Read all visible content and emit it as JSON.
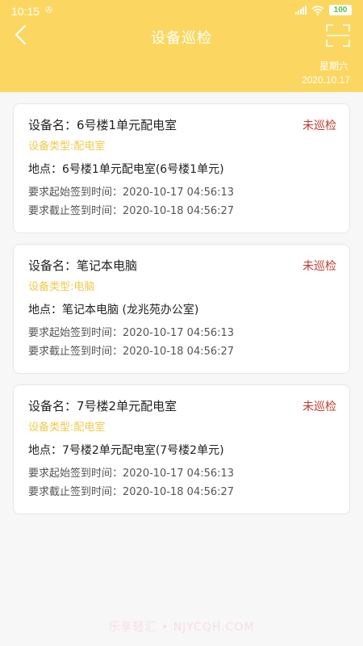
{
  "status_bar": {
    "time": "10:15",
    "notification_glyph": "✇",
    "battery": "100",
    "colors": {
      "battery_text": "#5bbf4a"
    }
  },
  "header": {
    "title": "设备巡检",
    "weekday": "星期六",
    "date": "2020.10.17",
    "background": "#fbd761",
    "icons": {
      "back": "back-chevron-icon",
      "scan": "scan-icon"
    }
  },
  "devices": [
    {
      "name_label": "设备名：6号楼1单元配电室",
      "status": "未巡检",
      "type_label": "设备类型:配电室",
      "location_label": "地点：6号楼1单元配电室(6号楼1单元)",
      "start_label": "要求起始签到时间：2020-10-17 04:56:13",
      "end_label": "要求截止签到时间：2020-10-18 04:56:27"
    },
    {
      "name_label": "设备名：笔记本电脑",
      "status": "未巡检",
      "type_label": "设备类型:电脑",
      "location_label": "地点：笔记本电脑 (龙兆苑办公室)",
      "start_label": "要求起始签到时间：2020-10-17 04:56:13",
      "end_label": "要求截止签到时间：2020-10-18 04:56:27"
    },
    {
      "name_label": "设备名：7号楼2单元配电室",
      "status": "未巡检",
      "type_label": "设备类型:配电室",
      "location_label": "地点：7号楼2单元配电室(7号楼2单元)",
      "start_label": "要求起始签到时间：2020-10-17 04:56:13",
      "end_label": "要求截止签到时间：2020-10-18 04:56:27"
    }
  ],
  "colors": {
    "status_unchecked": "#c0392b",
    "device_type": "#f0c94a"
  },
  "watermark": "乐享轻汇 • NJYCQH.COM"
}
